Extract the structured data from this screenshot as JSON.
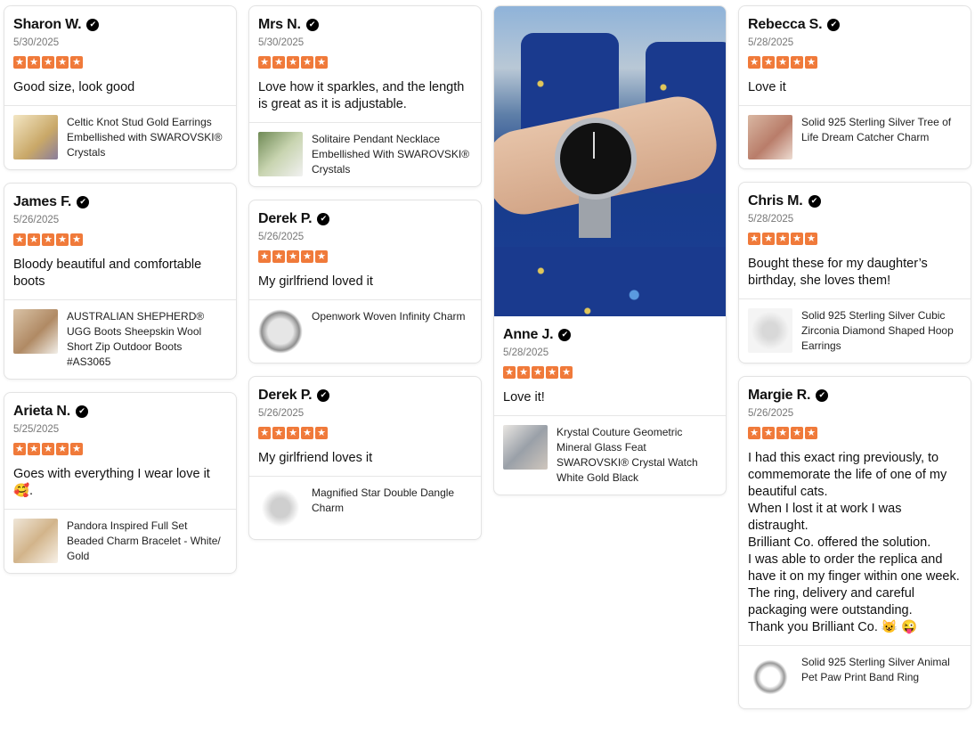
{
  "ui": {
    "verified_icon": "check-badge-icon",
    "star_icon": "star-icon",
    "accent": "#f07a3a"
  },
  "columns": [
    [
      {
        "name": "Sharon W.",
        "date": "5/30/2025",
        "rating": 5,
        "text": "Good size, look good",
        "product": "Celtic Knot Stud Gold Earrings Embellished with SWAROVSKI® Crystals"
      },
      {
        "name": "James F.",
        "date": "5/26/2025",
        "rating": 5,
        "text": "Bloody beautiful and comfortable boots",
        "product": "AUSTRALIAN SHEPHERD® UGG Boots Sheepskin Wool Short Zip Outdoor Boots #AS3065"
      },
      {
        "name": "Arieta N.",
        "date": "5/25/2025",
        "rating": 5,
        "text": "Goes with everything I wear love it 🥰.",
        "product": "Pandora Inspired Full Set Beaded Charm Bracelet - White/ Gold"
      }
    ],
    [
      {
        "name": "Mrs N.",
        "date": "5/30/2025",
        "rating": 5,
        "text": "Love how it sparkles, and the length is great as it is adjustable.",
        "product": "Solitaire Pendant Necklace Embellished With SWAROVSKI® Crystals"
      },
      {
        "name": "Derek P.",
        "date": "5/26/2025",
        "rating": 5,
        "text": "My girlfriend loved it",
        "product": "Openwork Woven Infinity Charm"
      },
      {
        "name": "Derek P.",
        "date": "5/26/2025",
        "rating": 5,
        "text": "My girlfriend loves it",
        "product": "Magnified Star Double Dangle Charm"
      }
    ],
    [
      {
        "name": "Anne J.",
        "date": "5/28/2025",
        "rating": 5,
        "text": "Love it!",
        "has_photo": true,
        "product": "Krystal Couture Geometric Mineral Glass Feat SWAROVSKI® Crystal Watch White Gold Black"
      }
    ],
    [
      {
        "name": "Rebecca S.",
        "date": "5/28/2025",
        "rating": 5,
        "text": "Love it",
        "product": "Solid 925 Sterling Silver Tree of Life Dream Catcher Charm"
      },
      {
        "name": "Chris M.",
        "date": "5/28/2025",
        "rating": 5,
        "text": "Bought these for my daughter’s birthday, she loves them!",
        "product": "Solid 925 Sterling Silver Cubic Zirconia Diamond Shaped Hoop Earrings"
      },
      {
        "name": "Margie R.",
        "date": "5/26/2025",
        "rating": 5,
        "text": "I had this exact ring previously, to commemorate the life of one of my beautiful cats.\nWhen I lost it at work I was distraught.\nBrilliant Co. offered the solution.\nI was able to order the replica and have it on my finger within one week.\nThe ring, delivery and careful packaging were outstanding.\nThank you Brilliant Co. 😺 😜",
        "product": "Solid 925 Sterling Silver Animal Pet Paw Print Band Ring"
      }
    ]
  ]
}
